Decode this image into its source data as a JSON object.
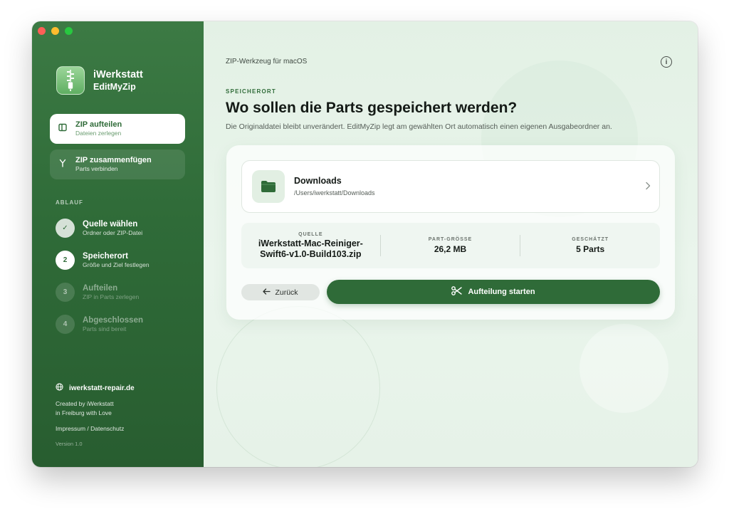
{
  "app": {
    "name": "iWerkstatt",
    "product": "EditMyZip"
  },
  "modes": [
    {
      "title": "ZIP aufteilen",
      "subtitle": "Dateien zerlegen",
      "icon": "split-panel-icon",
      "active": true
    },
    {
      "title": "ZIP zusammenfügen",
      "subtitle": "Parts verbinden",
      "icon": "merge-icon",
      "active": false
    }
  ],
  "workflow": {
    "label": "ABLAUF",
    "steps": [
      {
        "badge": "✓",
        "title": "Quelle wählen",
        "subtitle": "Ordner oder ZIP-Datei",
        "state": "done"
      },
      {
        "badge": "2",
        "title": "Speicherort",
        "subtitle": "Größe und Ziel festlegen",
        "state": "current"
      },
      {
        "badge": "3",
        "title": "Aufteilen",
        "subtitle": "ZIP in Parts zerlegen",
        "state": "pending"
      },
      {
        "badge": "4",
        "title": "Abgeschlossen",
        "subtitle": "Parts sind bereit",
        "state": "pending"
      }
    ]
  },
  "footer": {
    "website": "iwerkstatt-repair.de",
    "credit_line1": "Created by iWerkstatt",
    "credit_line2": "in Freiburg with Love",
    "legal": "Impressum / Datenschutz",
    "version": "Version 1.0"
  },
  "main": {
    "topline": "ZIP-Werkzeug für macOS",
    "eyebrow": "SPEICHERORT",
    "headline": "Wo sollen die Parts gespeichert werden?",
    "subline": "Die Originaldatei bleibt unverändert. EditMyZip legt am gewählten Ort automatisch einen eigenen Ausgabeordner an.",
    "location": {
      "name": "Downloads",
      "path": "/Users/iwerkstatt/Downloads"
    },
    "summary": {
      "source_label": "QUELLE",
      "source_value_line1": "iWerkstatt-Mac-Reiniger-",
      "source_value_line2": "Swift6-v1.0-Build103.zip",
      "part_size_label": "PART-GRÖSSE",
      "part_size_value": "26,2 MB",
      "estimate_label": "GESCHÄTZT",
      "estimate_value": "5 Parts"
    },
    "back_label": "Zurück",
    "start_label": "Aufteilung starten"
  },
  "colors": {
    "accent": "#2f6b38",
    "sidebar": "#346f3c",
    "background": "#eaf4ec"
  }
}
